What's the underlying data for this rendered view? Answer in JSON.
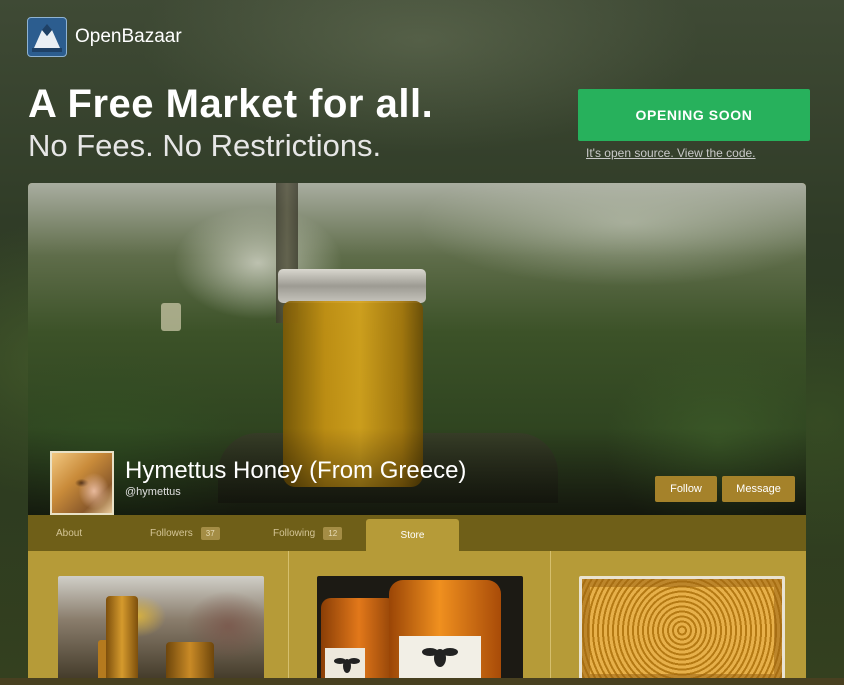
{
  "header": {
    "brand": "OpenBazaar",
    "logo_icon": "openbazaar-logo-icon"
  },
  "hero": {
    "title": "A Free Market for all.",
    "subtitle": "No Fees. No Restrictions.",
    "cta_label": "OPENING SOON",
    "source_link": "It's open source. View the code."
  },
  "store": {
    "name": "Hymettus Honey (From Greece)",
    "handle": "@hymettus",
    "follow_label": "Follow",
    "message_label": "Message",
    "tabs": [
      {
        "label": "About"
      },
      {
        "label": "Followers",
        "count": "37"
      },
      {
        "label": "Following",
        "count": "12"
      },
      {
        "label": "Store",
        "active": true
      }
    ],
    "products": [
      {
        "image": "honey-jars-branches-photo"
      },
      {
        "image": "honey-jars-labels-photo"
      },
      {
        "image": "honeycomb-frame-photo"
      }
    ]
  },
  "colors": {
    "cta_green": "#27b15c",
    "tab_active": "#b69b38",
    "tab_bar": "#6f5f18",
    "store_button": "#a5822a"
  }
}
